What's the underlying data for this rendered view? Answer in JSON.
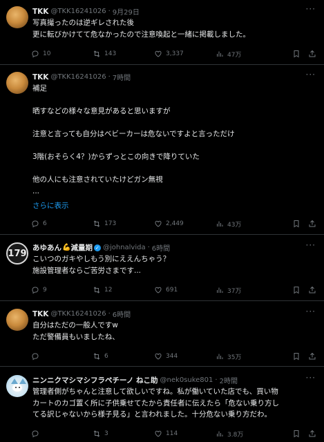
{
  "tweets": [
    {
      "name": "TKK",
      "handle": "@TKK16241026",
      "dot": "·",
      "time": "9月29日",
      "more": "···",
      "lines": [
        "写真撮ったのは逆ギレされた後",
        "更に転びかけてて危なかったので注意喚起と一緒に掲載しました。"
      ],
      "reply": "10",
      "retweet": "143",
      "like": "3,337",
      "views": "47万"
    },
    {
      "name": "TKK",
      "handle": "@TKK16241026",
      "dot": "·",
      "time": "7時間",
      "more": "···",
      "lines": [
        "補足",
        "",
        "晒すなどの様々な意見があると思いますが",
        "",
        "注意と言っても自分はベビーカーは危ないですよと言っただけ",
        "",
        "3階(おそらく4？)からずっとこの向きで降りていた",
        "",
        "他の人にも注意されていたけどガン無視",
        "..."
      ],
      "show_more": "さらに表示",
      "reply": "6",
      "retweet": "173",
      "like": "2,449",
      "views": "43万"
    },
    {
      "name": "あゆあん",
      "name_emoji": "💪",
      "name_suffix": "減量期",
      "avatar_text": "179",
      "handle": "@johnalvida",
      "dot": "·",
      "time": "6時間",
      "more": "···",
      "lines": [
        "こいつのガキやしもう別にええんちゃう？",
        "施設管理者ならご苦労さまです..."
      ],
      "reply": "9",
      "retweet": "12",
      "like": "691",
      "views": "37万"
    },
    {
      "name": "TKK",
      "handle": "@TKK16241026",
      "dot": "·",
      "time": "6時間",
      "more": "···",
      "lines": [
        "自分はただの一般人ですw",
        "ただ警備員もいましたね、"
      ],
      "reply": "",
      "retweet": "6",
      "like": "344",
      "views": "35万"
    },
    {
      "name": "ニンニクマシマシフラペチーノ ねこ助",
      "handle": "@nek0suke801",
      "dot": "·",
      "time": "2時間",
      "more": "···",
      "lines": [
        "管理者側がちゃんと注意して欲しいですね。私が働いていた店でも、買い物",
        "カートのカゴ置く所に子供乗せてたから責任者に伝えたら「危ない乗り方し",
        "てる訳じゃないから様子見る」と言われました。十分危ない乗り方だわ。"
      ],
      "reply": "",
      "retweet": "3",
      "like": "114",
      "views": "3.8万"
    }
  ]
}
